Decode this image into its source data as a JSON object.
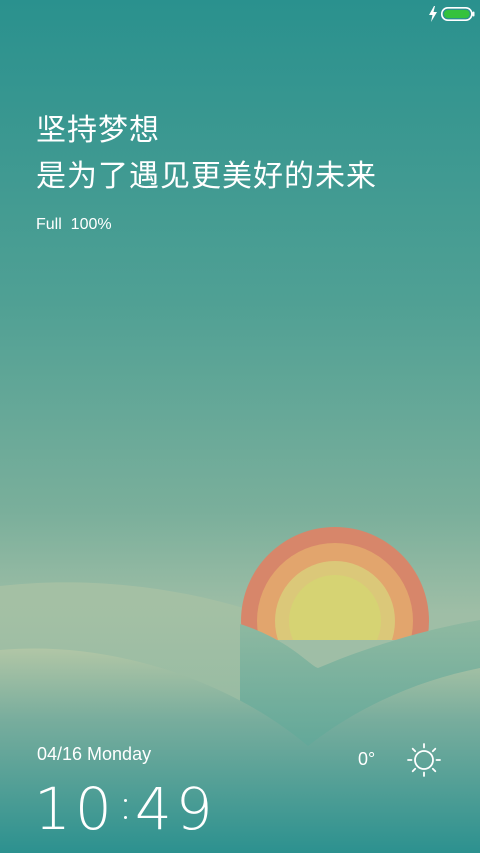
{
  "status_bar": {
    "charging_icon": "lightning-bolt-icon",
    "battery_icon": "battery-icon",
    "battery_color": "#35c23d"
  },
  "quote": {
    "line1": "坚持梦想",
    "line2": "是为了遇见更美好的未来"
  },
  "battery_status": "Full  100%",
  "date": "04/16 Monday",
  "clock": {
    "hours": "10",
    "minutes": "49"
  },
  "weather": {
    "temperature": "0°",
    "icon": "sun-icon"
  },
  "colors": {
    "sky_top": "#2a918e",
    "sky_bottom": "#9dbda6",
    "sun_outer": "#d7866a",
    "sun_mid": "#e2a56d",
    "sun_inner": "#dac97a",
    "sun_core": "#d6d373"
  }
}
